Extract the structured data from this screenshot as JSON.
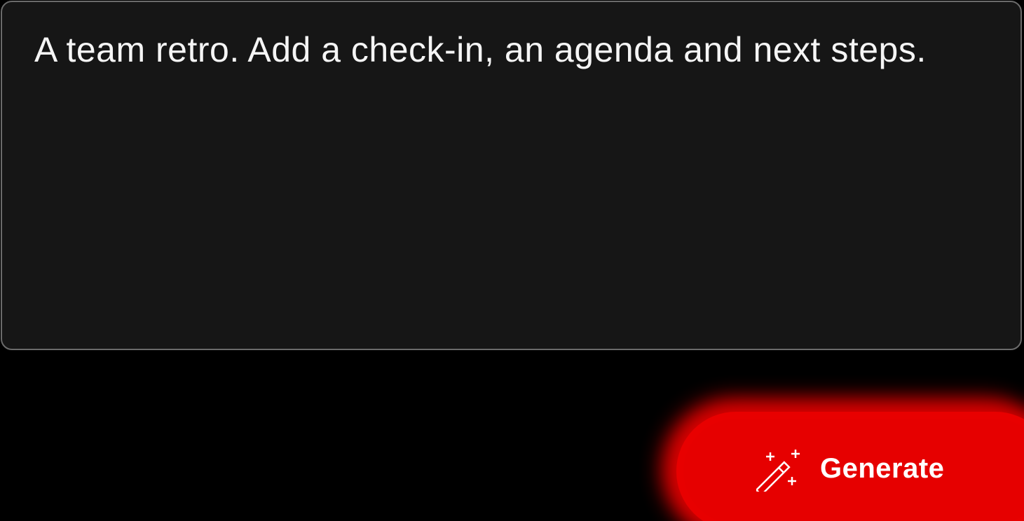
{
  "prompt": {
    "text": "A team retro. Add a check-in, an agenda and next steps."
  },
  "actions": {
    "generate_label": "Generate",
    "generate_icon": "magic-wand-sparkles-icon"
  },
  "colors": {
    "background": "#000000",
    "prompt_background": "#161616",
    "prompt_border": "#6b6b6b",
    "accent": "#e60000",
    "text": "#ffffff"
  }
}
